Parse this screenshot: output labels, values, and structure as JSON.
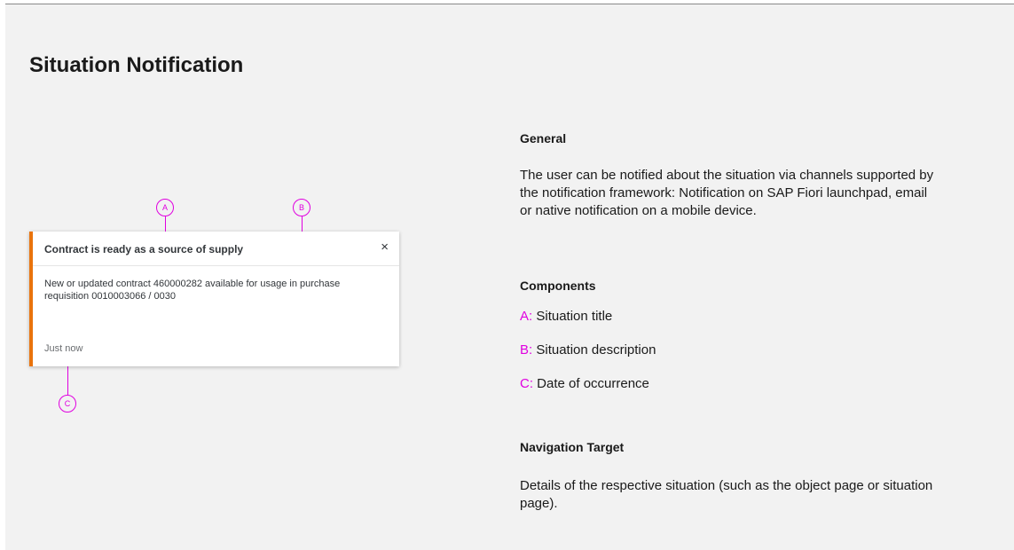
{
  "page": {
    "title": "Situation Notification"
  },
  "notification": {
    "title": "Contract is ready as a source of supply",
    "close_symbol": "×",
    "description": "New or updated contract 460000282 available for usage in purchase requisition 0010003066 / 0030",
    "timestamp": "Just now",
    "accent_color": "#e9730c"
  },
  "callouts": {
    "a": "A",
    "b": "B",
    "c": "C",
    "color": "#e000e0"
  },
  "general": {
    "heading": "General",
    "text": "The user can be notified about the situation via channels supported by the notification framework: Notification on SAP Fiori launchpad, email or native notification on a mobile device."
  },
  "components": {
    "heading": "Components",
    "items": [
      {
        "key": "A:",
        "label": "Situation title"
      },
      {
        "key": "B:",
        "label": "Situation description"
      },
      {
        "key": "C:",
        "label": "Date of occurrence"
      }
    ]
  },
  "navigation": {
    "heading": "Navigation Target",
    "text": "Details of the respective situation (such as the object page or situation page)."
  }
}
